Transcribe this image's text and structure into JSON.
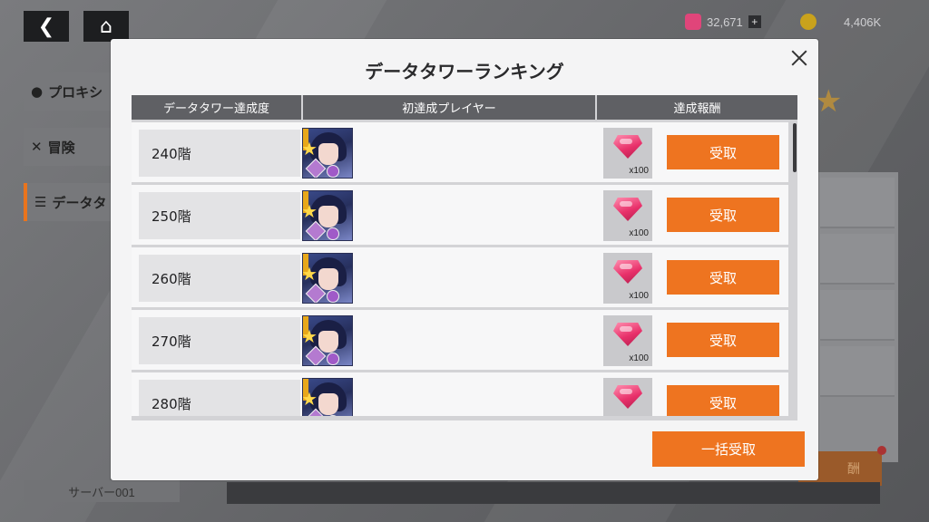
{
  "currencies": [
    {
      "name": "gem-currency",
      "value": "32,671",
      "icon": "gem-icon",
      "color": "#e0457a"
    },
    {
      "name": "coin-currency",
      "value": "4,406K",
      "icon": "coin-icon",
      "color": "#c9a21c"
    }
  ],
  "sidebar": {
    "items": [
      {
        "label": "プロキシ",
        "icon": "proxy-icon"
      },
      {
        "label": "冒険",
        "icon": "crossed-swords-icon"
      },
      {
        "label": "データタ",
        "icon": "layers-icon"
      }
    ],
    "server": "サーバー001"
  },
  "background": {
    "orange_button": "酬"
  },
  "modal": {
    "title": "データタワーランキング",
    "headers": [
      "データタワー達成度",
      "初達成プレイヤー",
      "達成報酬"
    ],
    "rows": [
      {
        "floor": "240階",
        "reward_qty": "x100",
        "claim": "受取"
      },
      {
        "floor": "250階",
        "reward_qty": "x100",
        "claim": "受取"
      },
      {
        "floor": "260階",
        "reward_qty": "x100",
        "claim": "受取"
      },
      {
        "floor": "270階",
        "reward_qty": "x100",
        "claim": "受取"
      },
      {
        "floor": "280階",
        "reward_qty": "",
        "claim": "受取"
      }
    ],
    "claim_all": "一括受取"
  },
  "colors": {
    "accent": "#ee7420",
    "header_bg": "#5f6064"
  }
}
